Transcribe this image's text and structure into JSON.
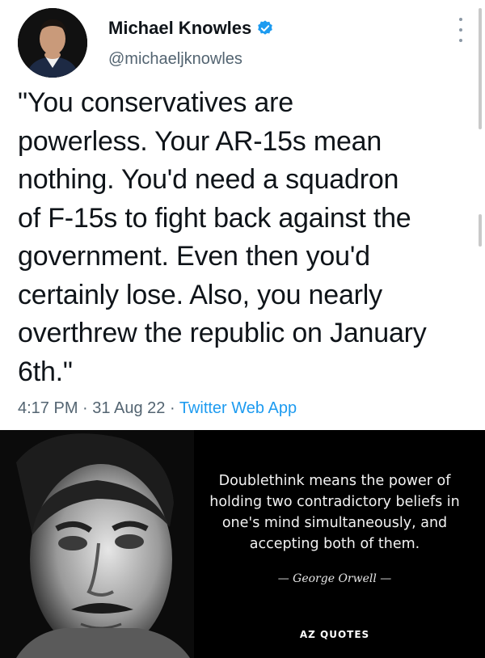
{
  "tweet": {
    "display_name": "Michael Knowles",
    "handle": "@michaeljknowles",
    "text": "\"You conservatives are\npowerless. Your AR-15s mean\nnothing. You'd need a squadron\nof F-15s to fight back against the\ngovernment. Even then you'd\ncertainly lose. Also, you nearly\noverthrew the republic on January\n6th.\"",
    "time": "4:17 PM",
    "separator": "·",
    "date": "31 Aug 22",
    "app": "Twitter Web App",
    "verified_color": "#1d9bf0",
    "link_color": "#1d9bf0"
  },
  "quote_image": {
    "quote": "Doublethink means the power of holding two contradictory beliefs in one's mind simultaneously, and accepting both of them.",
    "author": "George Orwell",
    "brand": "AZ QUOTES"
  }
}
